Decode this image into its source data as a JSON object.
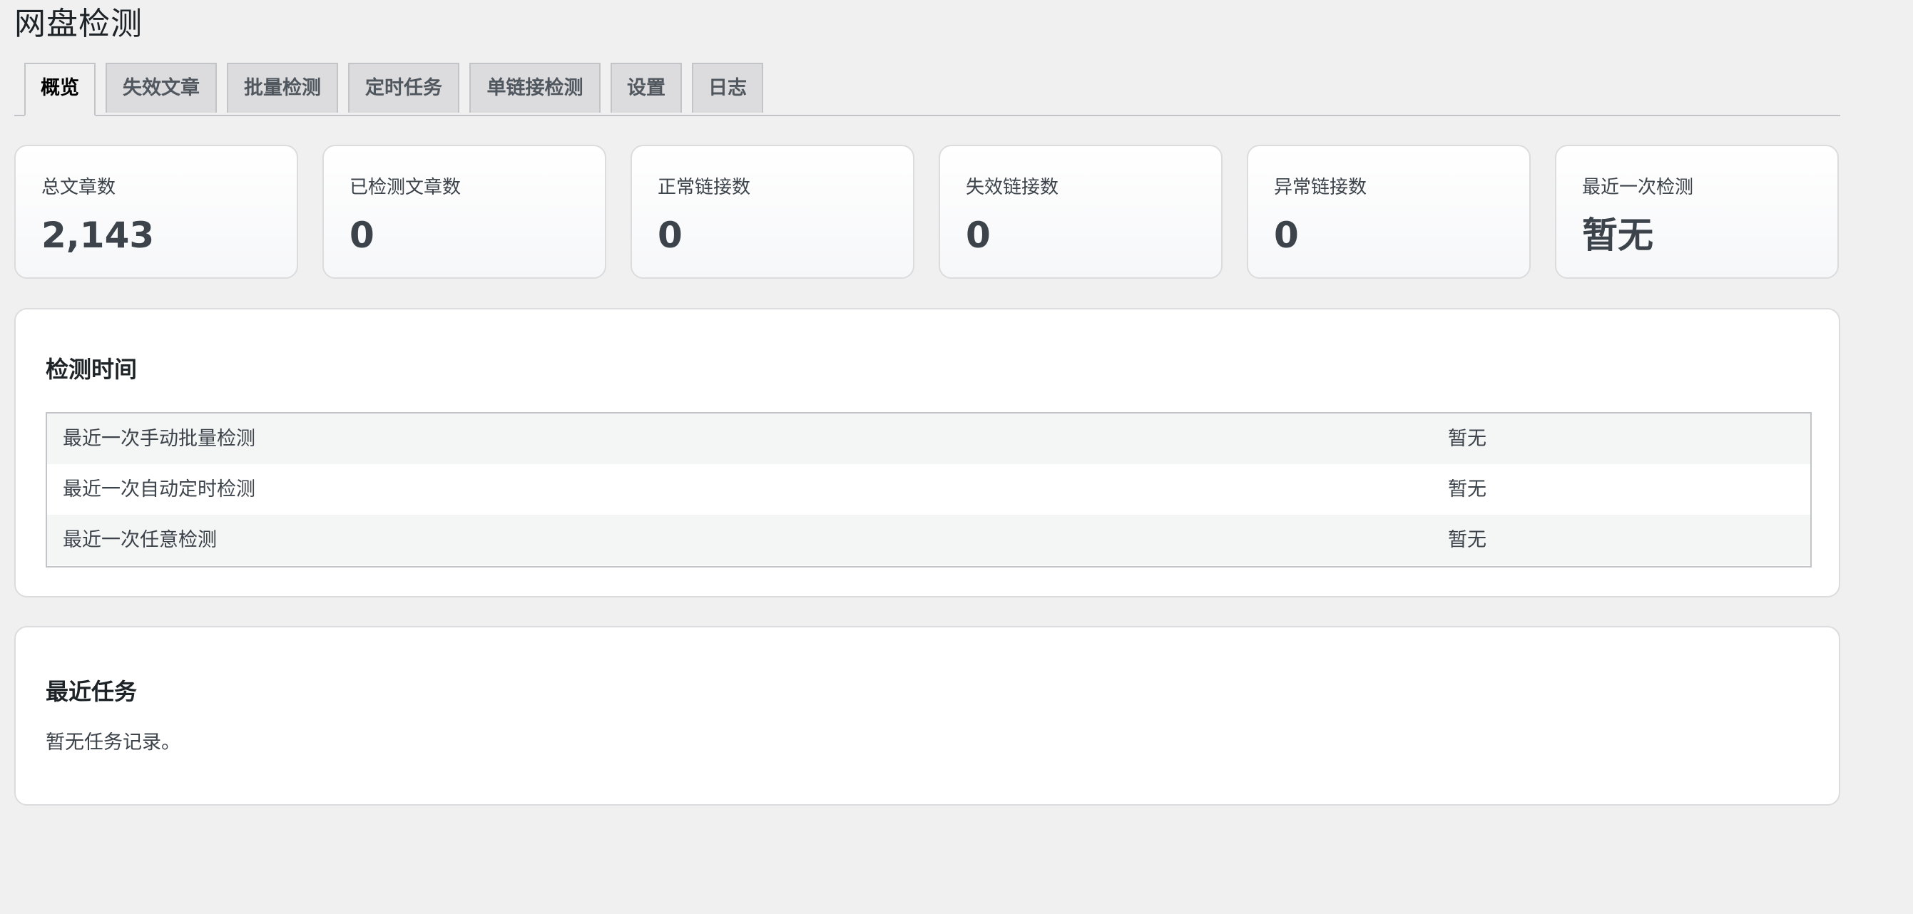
{
  "page": {
    "title": "网盘检测"
  },
  "tabs": [
    {
      "label": "概览",
      "active": true
    },
    {
      "label": "失效文章",
      "active": false
    },
    {
      "label": "批量检测",
      "active": false
    },
    {
      "label": "定时任务",
      "active": false
    },
    {
      "label": "单链接检测",
      "active": false
    },
    {
      "label": "设置",
      "active": false
    },
    {
      "label": "日志",
      "active": false
    }
  ],
  "stats": [
    {
      "label": "总文章数",
      "value": "2,143"
    },
    {
      "label": "已检测文章数",
      "value": "0"
    },
    {
      "label": "正常链接数",
      "value": "0"
    },
    {
      "label": "失效链接数",
      "value": "0"
    },
    {
      "label": "异常链接数",
      "value": "0"
    },
    {
      "label": "最近一次检测",
      "value": "暂无"
    }
  ],
  "check_time": {
    "title": "检测时间",
    "rows": [
      {
        "label": "最近一次手动批量检测",
        "value": "暂无"
      },
      {
        "label": "最近一次自动定时检测",
        "value": "暂无"
      },
      {
        "label": "最近一次任意检测",
        "value": "暂无"
      }
    ]
  },
  "recent_tasks": {
    "title": "最近任务",
    "empty_text": "暂无任务记录。"
  },
  "colors": {
    "background": "#f0f0f1",
    "card_border": "#dcdcde",
    "tab_inactive": "#dcdcde",
    "text": "#1d2327",
    "muted_text": "#3c434a"
  }
}
